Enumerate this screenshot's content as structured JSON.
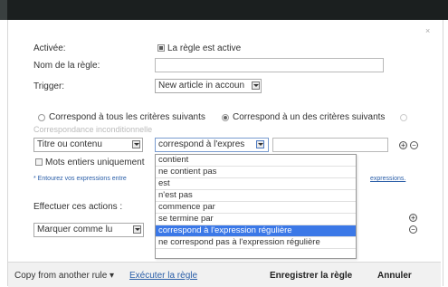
{
  "dialog": {
    "close_label": "×",
    "active_label": "Activée:",
    "active_checkbox_label": "La règle est active",
    "rule_name_label": "Nom de la règle:",
    "rule_name_value": "",
    "trigger_label": "Trigger:",
    "trigger_value": "New article in accoun",
    "match_all_label": "Correspond à tous les critères suivants",
    "match_any_label": "Correspond à un des critères suivants",
    "unconditional_label": "Correspondance inconditionnelle",
    "field_value": "Titre ou contenu",
    "operator_value": "correspond à l'expres",
    "value_input": "",
    "add_icon": "plus-circle-icon",
    "remove_icon": "minus-circle-icon",
    "whole_words_label": "Mots entiers uniquement",
    "hint_prefix": "* Entourez vos expressions entre",
    "hint_link": "expressions.",
    "actions_label": "Effectuer ces actions :",
    "action_value": "Marquer comme lu",
    "operator_options": [
      "contient",
      "ne contient pas",
      "est",
      "n'est pas",
      "commence par",
      "se termine par",
      "correspond à l'expression régulière",
      "ne correspond pas à l'expression régulière"
    ],
    "selected_option": "correspond à l'expression régulière"
  },
  "footer": {
    "copy_label": "Copy from another rule ▾",
    "run_label": "Exécuter la règle",
    "save_label": "Enregistrer la règle",
    "cancel_label": "Annuler"
  },
  "colors": {
    "topbar": "#1b1f1f",
    "selected_option": "#3b78e7",
    "link": "#2a5ea8"
  }
}
